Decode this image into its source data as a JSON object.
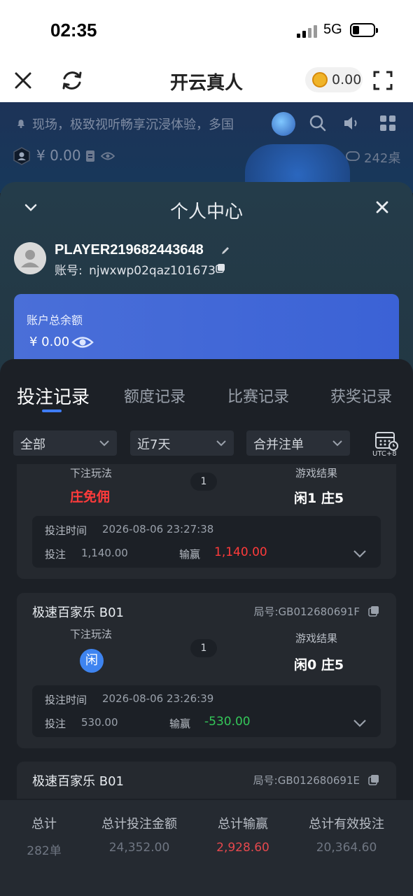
{
  "status_bar": {
    "time": "02:35",
    "network": "5G"
  },
  "top_nav": {
    "title": "开云真人",
    "coin_balance": "0.00"
  },
  "game": {
    "marquee": "现场，极致视听畅享沉浸体验，多国",
    "wallet_amount": "¥ 0.00",
    "tables_count": "242桌"
  },
  "personal_center": {
    "title": "个人中心",
    "username": "PLAYER219682443648",
    "account_label": "账号:",
    "account_id": "njwxwp02qaz101673",
    "balance_label": "账户总余额",
    "balance_value": "¥ 0.00"
  },
  "tabs": [
    {
      "label": "投注记录",
      "active": true
    },
    {
      "label": "额度记录",
      "active": false
    },
    {
      "label": "比赛记录",
      "active": false
    },
    {
      "label": "获奖记录",
      "active": false
    }
  ],
  "filters": [
    {
      "selected": "全部"
    },
    {
      "selected": "近7天"
    },
    {
      "selected": "合并注单"
    }
  ],
  "utc_label": "UTC+8",
  "records": [
    {
      "game": "",
      "round_no": "",
      "bet_play_label": "下注玩法",
      "bet_play": "庄免佣",
      "quantity": "1",
      "result_label": "游戏结果",
      "result": "闲1 庄5",
      "time_label": "投注时间",
      "time": "2026-08-06 23:27:38",
      "bet_label": "投注",
      "bet": "1,140.00",
      "win_label": "输赢",
      "win": "1,140.00",
      "win_color": "#ff3b3b"
    },
    {
      "game": "极速百家乐 B01",
      "round_no": "局号:GB012680691F",
      "bet_play_label": "下注玩法",
      "bet_play": "闲",
      "quantity": "1",
      "result_label": "游戏结果",
      "result": "闲0 庄5",
      "time_label": "投注时间",
      "time": "2026-08-06 23:26:39",
      "bet_label": "投注",
      "bet": "530.00",
      "win_label": "输赢",
      "win": "-530.00",
      "win_color": "#34c759"
    },
    {
      "game": "极速百家乐 B01",
      "round_no": "局号:GB012680691E"
    }
  ],
  "totals": [
    {
      "label": "总计",
      "value": "282单",
      "color": "#6f7682"
    },
    {
      "label": "总计投注金额",
      "value": "24,352.00",
      "color": "#6f7682"
    },
    {
      "label": "总计输赢",
      "value": "2,928.60",
      "color": "#e5484d"
    },
    {
      "label": "总计有效投注",
      "value": "20,364.60",
      "color": "#6f7682"
    }
  ]
}
